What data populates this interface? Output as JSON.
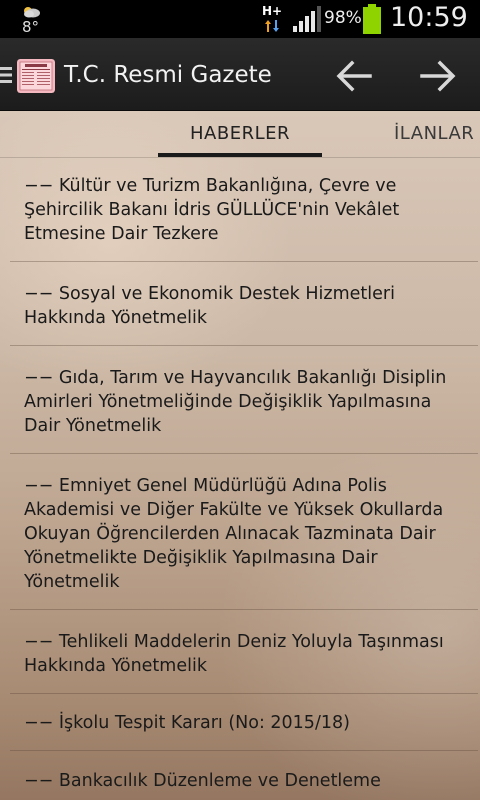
{
  "status_bar": {
    "temperature": "8°",
    "network_type": "H+",
    "battery_percent": "98%",
    "battery_level": 0.98,
    "time": "10:59"
  },
  "action_bar": {
    "title": "T.C. Resmi Gazete",
    "app_icon": "resmi-gazete-newspaper-icon",
    "back_icon": "arrow-left-icon",
    "forward_icon": "arrow-right-icon"
  },
  "tabs": [
    {
      "label": "HABERLER",
      "selected": true
    },
    {
      "label": "İLANLAR",
      "selected": false
    }
  ],
  "news": [
    {
      "text": "−− Kültür ve Turizm Bakanlığına, Çevre ve Şehircilik Bakanı İdris GÜLLÜCE'nin Vekâlet Etmesine Dair Tezkere"
    },
    {
      "text": "−− Sosyal ve Ekonomik Destek Hizmetleri Hakkında Yönetmelik"
    },
    {
      "text": "−− Gıda, Tarım ve Hayvancılık Bakanlığı Disiplin Amirleri Yönetmeliğinde Değişiklik Yapılmasına Dair Yönetmelik"
    },
    {
      "text": "−− Emniyet Genel Müdürlüğü Adına Polis Akademisi ve Diğer Fakülte ve Yüksek Okullarda Okuyan Öğrencilerden Alınacak Tazminata Dair Yönetmelikte Değişiklik Yapılmasına Dair Yönetmelik"
    },
    {
      "text": "−− Tehlikeli Maddelerin Deniz Yoluyla Taşınması Hakkında Yönetmelik"
    },
    {
      "text": "−− İşkolu Tespit Kararı (No: 2015/18)"
    },
    {
      "text": "−− Bankacılık Düzenleme ve Denetleme"
    }
  ],
  "colors": {
    "status_bar_bg": "#000000",
    "action_bar_bg": "#1f1f1f",
    "battery_green": "#8fd400",
    "tab_indicator": "#1a1a1a"
  }
}
